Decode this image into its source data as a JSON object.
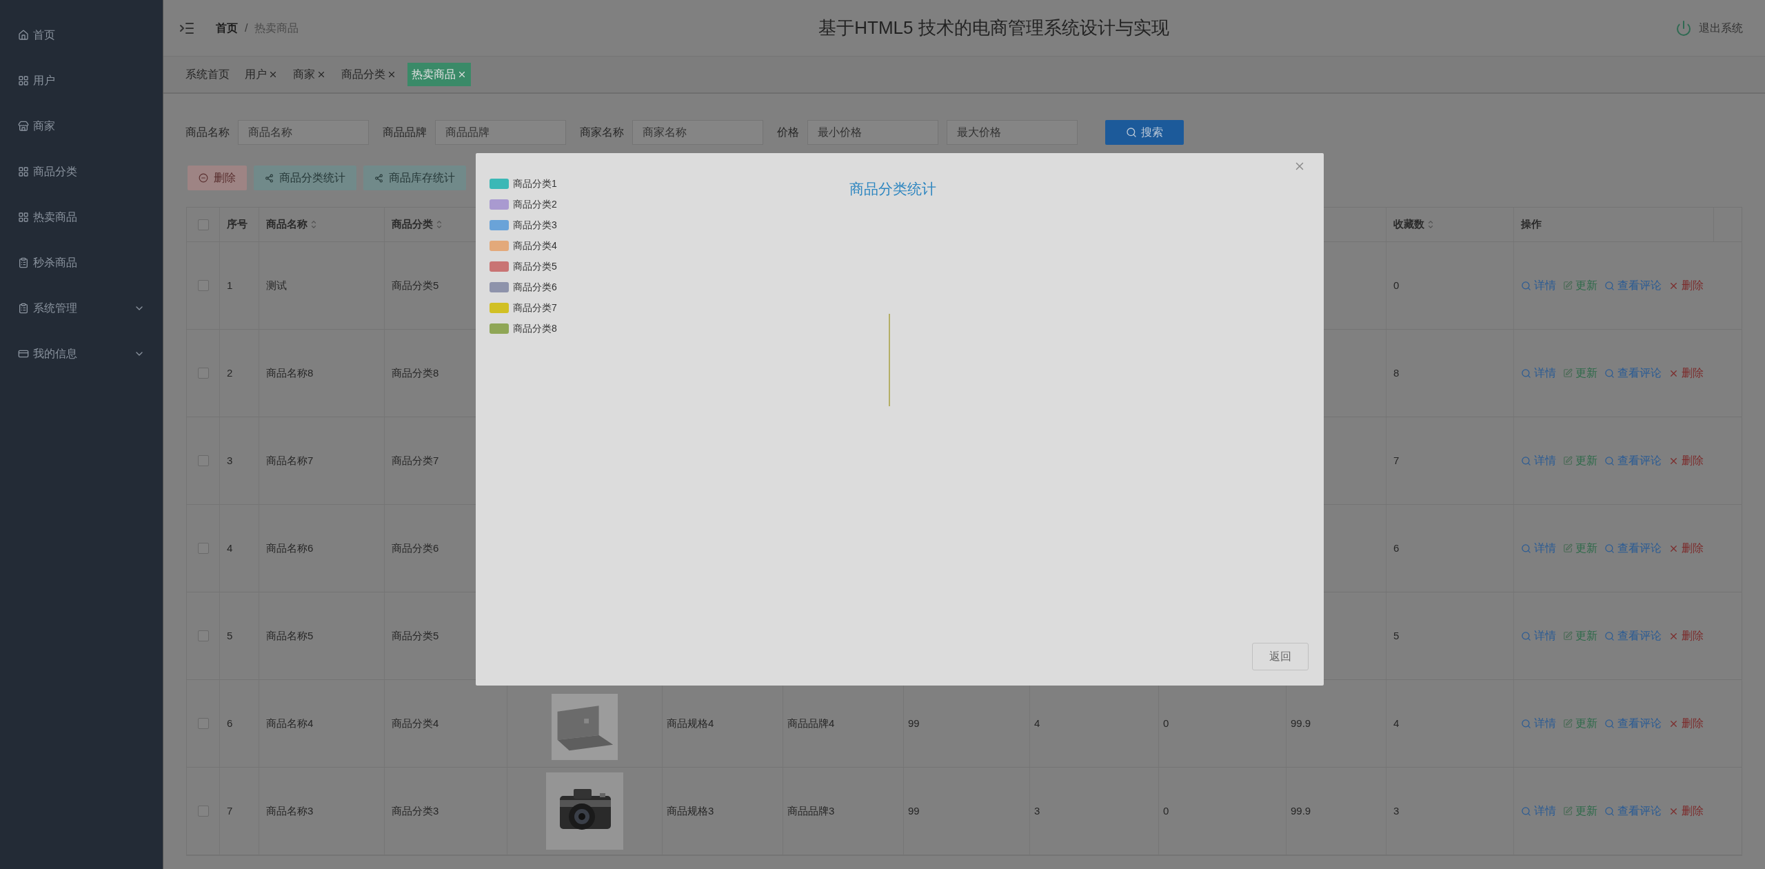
{
  "sidebar": {
    "items": [
      {
        "label": "首页",
        "kind": "link"
      },
      {
        "label": "用户",
        "kind": "link"
      },
      {
        "label": "商家",
        "kind": "link"
      },
      {
        "label": "商品分类",
        "kind": "link"
      },
      {
        "label": "热卖商品",
        "kind": "link"
      },
      {
        "label": "秒杀商品",
        "kind": "link"
      },
      {
        "label": "系统管理",
        "kind": "submenu"
      },
      {
        "label": "我的信息",
        "kind": "submenu"
      }
    ]
  },
  "header": {
    "breadcrumb": [
      "首页",
      "热卖商品"
    ],
    "separator": "/",
    "title": "基于HTML5 技术的电商管理系统设计与实现",
    "logout": "退出系统"
  },
  "tabs": [
    {
      "label": "系统首页",
      "closable": false,
      "selected": false
    },
    {
      "label": "用户",
      "closable": true,
      "selected": false
    },
    {
      "label": "商家",
      "closable": true,
      "selected": false
    },
    {
      "label": "商品分类",
      "closable": true,
      "selected": false
    },
    {
      "label": "热卖商品",
      "closable": true,
      "selected": true
    }
  ],
  "filters": [
    {
      "label": "商品名称",
      "placeholders": [
        "商品名称"
      ]
    },
    {
      "label": "商品品牌",
      "placeholders": [
        "商品品牌"
      ]
    },
    {
      "label": "商家名称",
      "placeholders": [
        "商家名称"
      ]
    },
    {
      "label": "价格",
      "placeholders": [
        "最小价格",
        "最大价格"
      ]
    }
  ],
  "search_button": "搜索",
  "toolbar": [
    {
      "label": "删除",
      "kind": "danger"
    },
    {
      "label": "商品分类统计",
      "kind": "chart"
    },
    {
      "label": "商品库存统计",
      "kind": "chart"
    }
  ],
  "table": {
    "header_checked": false,
    "columns_left": [
      {
        "label": "序号",
        "sortable": false
      },
      {
        "label": "商品名称",
        "sortable": true
      },
      {
        "label": "商品分类",
        "sortable": true
      }
    ],
    "columns_right": [
      {
        "label": "收藏数",
        "sortable": true
      },
      {
        "label": "操作"
      }
    ],
    "rows": [
      {
        "checked": false,
        "no": "1",
        "name": "测试",
        "category": "商品分类5",
        "favorites": "0",
        "actions": [
          {
            "label": "详情",
            "kind": "view"
          },
          {
            "label": "更新",
            "kind": "edit"
          },
          {
            "label": "查看评论",
            "kind": "view"
          },
          {
            "label": "删除",
            "kind": "delete"
          }
        ]
      },
      {
        "checked": false,
        "no": "2",
        "name": "商品名称8",
        "category": "商品分类8",
        "favorites": "8",
        "actions": [
          {
            "label": "详情",
            "kind": "view"
          },
          {
            "label": "更新",
            "kind": "edit"
          },
          {
            "label": "查看评论",
            "kind": "view"
          },
          {
            "label": "删除",
            "kind": "delete"
          }
        ]
      },
      {
        "checked": false,
        "no": "3",
        "name": "商品名称7",
        "category": "商品分类7",
        "favorites": "7",
        "actions": [
          {
            "label": "详情",
            "kind": "view"
          },
          {
            "label": "更新",
            "kind": "edit"
          },
          {
            "label": "查看评论",
            "kind": "view"
          },
          {
            "label": "删除",
            "kind": "delete"
          }
        ]
      },
      {
        "checked": false,
        "no": "4",
        "name": "商品名称6",
        "category": "商品分类6",
        "favorites": "6",
        "actions": [
          {
            "label": "详情",
            "kind": "view"
          },
          {
            "label": "更新",
            "kind": "edit"
          },
          {
            "label": "查看评论",
            "kind": "view"
          },
          {
            "label": "删除",
            "kind": "delete"
          }
        ]
      },
      {
        "checked": false,
        "no": "5",
        "name": "商品名称5",
        "category": "商品分类5",
        "favorites": "5",
        "actions": [
          {
            "label": "详情",
            "kind": "view"
          },
          {
            "label": "更新",
            "kind": "edit"
          },
          {
            "label": "查看评论",
            "kind": "view"
          },
          {
            "label": "删除",
            "kind": "delete"
          }
        ]
      },
      {
        "checked": false,
        "no": "6",
        "name": "商品名称4",
        "category": "商品分类4",
        "image": {
          "kind": "picture"
        },
        "middle": [
          "商品规格4",
          "商品品牌4",
          "99",
          "4",
          "0",
          "99.9"
        ],
        "favorites": "4",
        "actions": [
          {
            "label": "详情",
            "kind": "view"
          },
          {
            "label": "更新",
            "kind": "edit"
          },
          {
            "label": "查看评论",
            "kind": "view"
          },
          {
            "label": "删除",
            "kind": "delete"
          }
        ]
      },
      {
        "checked": false,
        "no": "7",
        "name": "商品名称3",
        "category": "商品分类3",
        "image": {
          "kind": "picture"
        },
        "middle": [
          "商品规格3",
          "商品品牌3",
          "99",
          "3",
          "0",
          "99.9"
        ],
        "favorites": "3",
        "actions": [
          {
            "label": "详情",
            "kind": "view"
          },
          {
            "label": "更新",
            "kind": "edit"
          },
          {
            "label": "查看评论",
            "kind": "view"
          },
          {
            "label": "删除",
            "kind": "delete"
          }
        ]
      }
    ]
  },
  "modal": {
    "title": "商品分类统计",
    "legend": [
      {
        "label": "商品分类1",
        "color": "#3bb8b6"
      },
      {
        "label": "商品分类2",
        "color": "#a99ad0"
      },
      {
        "label": "商品分类3",
        "color": "#6aa3d8"
      },
      {
        "label": "商品分类4",
        "color": "#e3a97a"
      },
      {
        "label": "商品分类5",
        "color": "#c97474"
      },
      {
        "label": "商品分类6",
        "color": "#8e93ab"
      },
      {
        "label": "商品分类7",
        "color": "#d1c024"
      },
      {
        "label": "商品分类8",
        "color": "#8fa656"
      }
    ],
    "button": "返回"
  }
}
